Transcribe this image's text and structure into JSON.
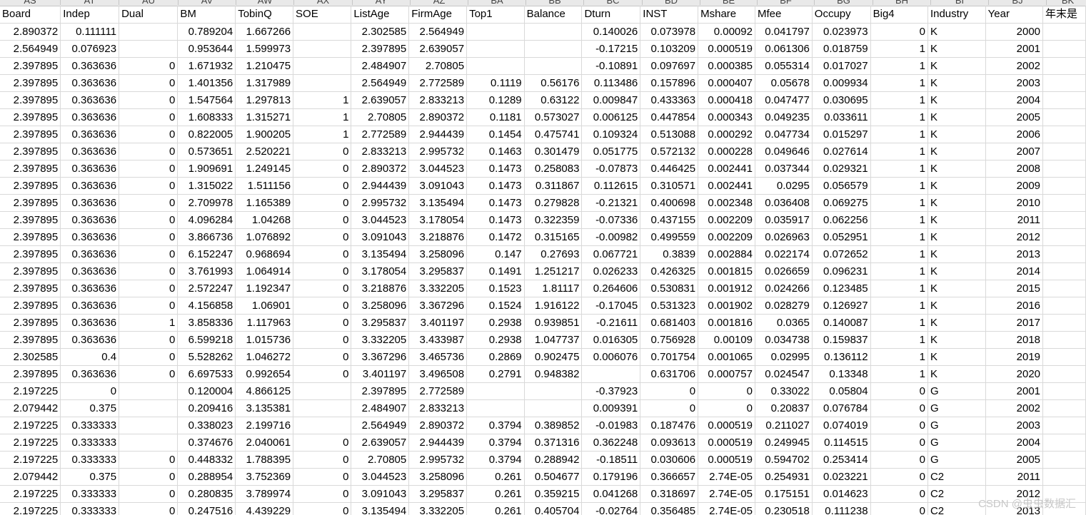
{
  "spreadsheet": {
    "column_letters": [
      "AS",
      "AT",
      "AU",
      "AV",
      "AW",
      "AX",
      "AY",
      "AZ",
      "BA",
      "BB",
      "BC",
      "BD",
      "BE",
      "BF",
      "BG",
      "BH",
      "BI",
      "BJ",
      "BK"
    ],
    "headers": [
      "Board",
      "Indep",
      "Dual",
      "BM",
      "TobinQ",
      "SOE",
      "ListAge",
      "FirmAge",
      "Top1",
      "Balance",
      "Dturn",
      "INST",
      "Mshare",
      "Mfee",
      "Occupy",
      "Big4",
      "Industry",
      "Year",
      "年末是"
    ],
    "rows": [
      [
        "2.890372",
        "0.111111",
        "",
        "0.789204",
        "1.667266",
        "",
        "2.302585",
        "2.564949",
        "",
        "",
        "0.140026",
        "0.073978",
        "0.00092",
        "0.041797",
        "0.023973",
        "0",
        "K",
        "2000",
        ""
      ],
      [
        "2.564949",
        "0.076923",
        "",
        "0.953644",
        "1.599973",
        "",
        "2.397895",
        "2.639057",
        "",
        "",
        "-0.17215",
        "0.103209",
        "0.000519",
        "0.061306",
        "0.018759",
        "1",
        "K",
        "2001",
        ""
      ],
      [
        "2.397895",
        "0.363636",
        "0",
        "1.671932",
        "1.210475",
        "",
        "2.484907",
        "2.70805",
        "",
        "",
        "-0.10891",
        "0.097697",
        "0.000385",
        "0.055314",
        "0.017027",
        "1",
        "K",
        "2002",
        ""
      ],
      [
        "2.397895",
        "0.363636",
        "0",
        "1.401356",
        "1.317989",
        "",
        "2.564949",
        "2.772589",
        "0.1119",
        "0.56176",
        "0.113486",
        "0.157896",
        "0.000407",
        "0.05678",
        "0.009934",
        "1",
        "K",
        "2003",
        ""
      ],
      [
        "2.397895",
        "0.363636",
        "0",
        "1.547564",
        "1.297813",
        "1",
        "2.639057",
        "2.833213",
        "0.1289",
        "0.63122",
        "0.009847",
        "0.433363",
        "0.000418",
        "0.047477",
        "0.030695",
        "1",
        "K",
        "2004",
        ""
      ],
      [
        "2.397895",
        "0.363636",
        "0",
        "1.608333",
        "1.315271",
        "1",
        "2.70805",
        "2.890372",
        "0.1181",
        "0.573027",
        "0.006125",
        "0.447854",
        "0.000343",
        "0.049235",
        "0.033611",
        "1",
        "K",
        "2005",
        ""
      ],
      [
        "2.397895",
        "0.363636",
        "0",
        "0.822005",
        "1.900205",
        "1",
        "2.772589",
        "2.944439",
        "0.1454",
        "0.475741",
        "0.109324",
        "0.513088",
        "0.000292",
        "0.047734",
        "0.015297",
        "1",
        "K",
        "2006",
        ""
      ],
      [
        "2.397895",
        "0.363636",
        "0",
        "0.573651",
        "2.520221",
        "0",
        "2.833213",
        "2.995732",
        "0.1463",
        "0.301479",
        "0.051775",
        "0.572132",
        "0.000228",
        "0.049646",
        "0.027614",
        "1",
        "K",
        "2007",
        ""
      ],
      [
        "2.397895",
        "0.363636",
        "0",
        "1.909691",
        "1.249145",
        "0",
        "2.890372",
        "3.044523",
        "0.1473",
        "0.258083",
        "-0.07873",
        "0.446425",
        "0.002441",
        "0.037344",
        "0.029321",
        "1",
        "K",
        "2008",
        ""
      ],
      [
        "2.397895",
        "0.363636",
        "0",
        "1.315022",
        "1.511156",
        "0",
        "2.944439",
        "3.091043",
        "0.1473",
        "0.311867",
        "0.112615",
        "0.310571",
        "0.002441",
        "0.0295",
        "0.056579",
        "1",
        "K",
        "2009",
        ""
      ],
      [
        "2.397895",
        "0.363636",
        "0",
        "2.709978",
        "1.165389",
        "0",
        "2.995732",
        "3.135494",
        "0.1473",
        "0.279828",
        "-0.21321",
        "0.400698",
        "0.002348",
        "0.036408",
        "0.069275",
        "1",
        "K",
        "2010",
        ""
      ],
      [
        "2.397895",
        "0.363636",
        "0",
        "4.096284",
        "1.04268",
        "0",
        "3.044523",
        "3.178054",
        "0.1473",
        "0.322359",
        "-0.07336",
        "0.437155",
        "0.002209",
        "0.035917",
        "0.062256",
        "1",
        "K",
        "2011",
        ""
      ],
      [
        "2.397895",
        "0.363636",
        "0",
        "3.866736",
        "1.076892",
        "0",
        "3.091043",
        "3.218876",
        "0.1472",
        "0.315165",
        "-0.00982",
        "0.499559",
        "0.002209",
        "0.026963",
        "0.052951",
        "1",
        "K",
        "2012",
        ""
      ],
      [
        "2.397895",
        "0.363636",
        "0",
        "6.152247",
        "0.968694",
        "0",
        "3.135494",
        "3.258096",
        "0.147",
        "0.27693",
        "0.067721",
        "0.3839",
        "0.002884",
        "0.022174",
        "0.072652",
        "1",
        "K",
        "2013",
        ""
      ],
      [
        "2.397895",
        "0.363636",
        "0",
        "3.761993",
        "1.064914",
        "0",
        "3.178054",
        "3.295837",
        "0.1491",
        "1.251217",
        "0.026233",
        "0.426325",
        "0.001815",
        "0.026659",
        "0.096231",
        "1",
        "K",
        "2014",
        ""
      ],
      [
        "2.397895",
        "0.363636",
        "0",
        "2.572247",
        "1.192347",
        "0",
        "3.218876",
        "3.332205",
        "0.1523",
        "1.81117",
        "0.264606",
        "0.530831",
        "0.001912",
        "0.024266",
        "0.123485",
        "1",
        "K",
        "2015",
        ""
      ],
      [
        "2.397895",
        "0.363636",
        "0",
        "4.156858",
        "1.06901",
        "0",
        "3.258096",
        "3.367296",
        "0.1524",
        "1.916122",
        "-0.17045",
        "0.531323",
        "0.001902",
        "0.028279",
        "0.126927",
        "1",
        "K",
        "2016",
        ""
      ],
      [
        "2.397895",
        "0.363636",
        "1",
        "3.858336",
        "1.117963",
        "0",
        "3.295837",
        "3.401197",
        "0.2938",
        "0.939851",
        "-0.21611",
        "0.681403",
        "0.001816",
        "0.0365",
        "0.140087",
        "1",
        "K",
        "2017",
        ""
      ],
      [
        "2.397895",
        "0.363636",
        "0",
        "6.599218",
        "1.015736",
        "0",
        "3.332205",
        "3.433987",
        "0.2938",
        "1.047737",
        "0.016305",
        "0.756928",
        "0.00109",
        "0.034738",
        "0.159837",
        "1",
        "K",
        "2018",
        ""
      ],
      [
        "2.302585",
        "0.4",
        "0",
        "5.528262",
        "1.046272",
        "0",
        "3.367296",
        "3.465736",
        "0.2869",
        "0.902475",
        "0.006076",
        "0.701754",
        "0.001065",
        "0.02995",
        "0.136112",
        "1",
        "K",
        "2019",
        ""
      ],
      [
        "2.397895",
        "0.363636",
        "0",
        "6.697533",
        "0.992654",
        "0",
        "3.401197",
        "3.496508",
        "0.2791",
        "0.948382",
        "",
        "0.631706",
        "0.000757",
        "0.024547",
        "0.13348",
        "1",
        "K",
        "2020",
        ""
      ],
      [
        "2.197225",
        "0",
        "",
        "0.120004",
        "4.866125",
        "",
        "2.397895",
        "2.772589",
        "",
        "",
        "-0.37923",
        "0",
        "0",
        "0.33022",
        "0.05804",
        "0",
        "G",
        "2001",
        ""
      ],
      [
        "2.079442",
        "0.375",
        "",
        "0.209416",
        "3.135381",
        "",
        "2.484907",
        "2.833213",
        "",
        "",
        "0.009391",
        "0",
        "0",
        "0.20837",
        "0.076784",
        "0",
        "G",
        "2002",
        ""
      ],
      [
        "2.197225",
        "0.333333",
        "",
        "0.338023",
        "2.199716",
        "",
        "2.564949",
        "2.890372",
        "0.3794",
        "0.389852",
        "-0.01983",
        "0.187476",
        "0.000519",
        "0.211027",
        "0.074019",
        "0",
        "G",
        "2003",
        ""
      ],
      [
        "2.197225",
        "0.333333",
        "",
        "0.374676",
        "2.040061",
        "0",
        "2.639057",
        "2.944439",
        "0.3794",
        "0.371316",
        "0.362248",
        "0.093613",
        "0.000519",
        "0.249945",
        "0.114515",
        "0",
        "G",
        "2004",
        ""
      ],
      [
        "2.197225",
        "0.333333",
        "0",
        "0.448332",
        "1.788395",
        "0",
        "2.70805",
        "2.995732",
        "0.3794",
        "0.288942",
        "-0.18511",
        "0.030606",
        "0.000519",
        "0.594702",
        "0.253414",
        "0",
        "G",
        "2005",
        ""
      ],
      [
        "2.079442",
        "0.375",
        "0",
        "0.288954",
        "3.752369",
        "0",
        "3.044523",
        "3.258096",
        "0.261",
        "0.504677",
        "0.179196",
        "0.366657",
        "2.74E-05",
        "0.254931",
        "0.023221",
        "0",
        "C2",
        "2011",
        ""
      ],
      [
        "2.197225",
        "0.333333",
        "0",
        "0.280835",
        "3.789974",
        "0",
        "3.091043",
        "3.295837",
        "0.261",
        "0.359215",
        "0.041268",
        "0.318697",
        "2.74E-05",
        "0.175151",
        "0.014623",
        "0",
        "C2",
        "2012",
        ""
      ],
      [
        "2.197225",
        "0.333333",
        "0",
        "0.247516",
        "4.439229",
        "0",
        "3.135494",
        "3.332205",
        "0.261",
        "0.405704",
        "-0.02764",
        "0.356485",
        "2.74E-05",
        "0.230518",
        "0.111238",
        "0",
        "C2",
        "2013",
        ""
      ]
    ]
  },
  "watermark": "CSDN @虫虫数据汇"
}
